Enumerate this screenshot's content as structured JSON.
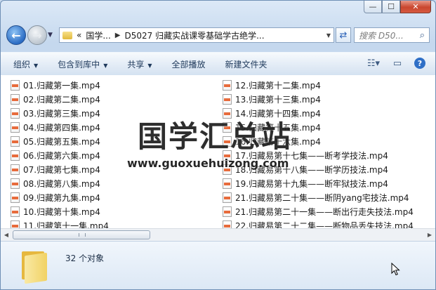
{
  "window": {
    "caption_buttons": {
      "minimize": "—",
      "maximize": "☐",
      "close": "✕"
    }
  },
  "nav": {
    "address_segments": [
      "«",
      "国学...",
      "D5027 归藏实战课零基础学古绝学..."
    ],
    "search_placeholder": "搜索 D50..."
  },
  "toolbar": {
    "items": [
      "组织",
      "包含到库中",
      "共享",
      "全部播放",
      "新建文件夹"
    ]
  },
  "files_left": [
    "01.归藏第一集.mp4",
    "02.归藏第二集.mp4",
    "03.归藏第三集.mp4",
    "04.归藏第四集.mp4",
    "05.归藏第五集.mp4",
    "06.归藏第六集.mp4",
    "07.归藏第七集.mp4",
    "08.归藏第八集.mp4",
    "09.归藏第九集.mp4",
    "10.归藏第十集.mp4",
    "11.归藏第十一集.mp4"
  ],
  "files_right": [
    "12.归藏第十二集.mp4",
    "13.归藏第十三集.mp4",
    "14.归藏第十四集.mp4",
    "15.归藏第十五集.mp4",
    "16.归藏第十六集.mp4",
    "17.归藏易第十七集——断考学技法.mp4",
    "18.归藏易第十八集——断学历技法.mp4",
    "19.归藏易第十九集——断牢狱技法.mp4",
    "21.归藏易第二十集——断阴yang宅技法.mp4",
    "21.归藏易第二十一集——断出行走失技法.mp4",
    "22.归藏易第二十二集——断物品丢失技法.mp4"
  ],
  "status": {
    "count": "32 个对象"
  },
  "watermark": {
    "cn": "国学汇总站",
    "url": "www.guoxuehuizong.com"
  }
}
